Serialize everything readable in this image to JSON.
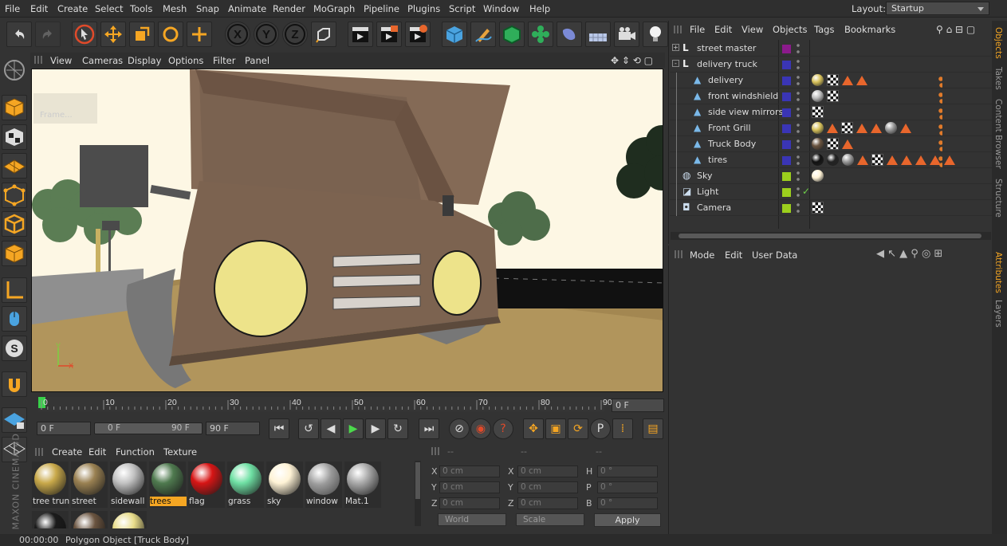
{
  "menubar": {
    "items": [
      "File",
      "Edit",
      "Create",
      "Select",
      "Tools",
      "Mesh",
      "Snap",
      "Animate",
      "Render",
      "MoGraph",
      "Pipeline",
      "Plugins",
      "Script",
      "Window",
      "Help"
    ],
    "layout_label": "Layout:",
    "layout_value": "Startup"
  },
  "toolbar": {
    "buttons": [
      "undo-icon",
      "redo-icon",
      "select-icon",
      "move-icon",
      "scale-icon",
      "rotate-icon",
      "live-select-icon",
      "x-axis-icon",
      "y-axis-icon",
      "z-axis-icon",
      "coordinate-system-icon",
      "render-view-icon",
      "render-picture-viewer-icon",
      "render-settings-icon",
      "cube-icon",
      "pen-icon",
      "subdivision-icon",
      "cloner-icon",
      "deformer-icon",
      "floor-icon",
      "camera-icon",
      "light-icon"
    ],
    "axis_x": "X",
    "axis_y": "Y",
    "axis_z": "Z"
  },
  "viewport_menu": [
    "View",
    "Cameras",
    "Display",
    "Options",
    "Filter",
    "Panel"
  ],
  "viewport_overlay": "Frame...",
  "timeline": {
    "ticks": [
      "0",
      "10",
      "20",
      "30",
      "40",
      "50",
      "60",
      "70",
      "80",
      "90"
    ],
    "current_frame": "0 F"
  },
  "controls": {
    "start_field": "0 F",
    "range_start": "0 F",
    "range_end": "90 F",
    "end_field": "90 F"
  },
  "material_manager": {
    "menu": [
      "Create",
      "Edit",
      "Function",
      "Texture"
    ],
    "materials": [
      {
        "name": "tree trun",
        "color": "#c9a94a"
      },
      {
        "name": "street",
        "color": "#9a8152"
      },
      {
        "name": "sidewall",
        "color": "#c2c2c2"
      },
      {
        "name": "trees",
        "color": "#4f7a4f",
        "selected": true
      },
      {
        "name": "flag",
        "color": "#d71515"
      },
      {
        "name": "grass",
        "color": "#6fe0a4"
      },
      {
        "name": "sky",
        "color": "#fff3d6"
      },
      {
        "name": "window",
        "color": "#8a8a8a"
      },
      {
        "name": "Mat.1",
        "color": "#aaaaaa"
      }
    ],
    "extra_materials": [
      "#1b1b1b",
      "#6a5440",
      "#e8dc8a"
    ]
  },
  "coordinates": {
    "col_headers": [
      "--",
      "--",
      "--"
    ],
    "rows": [
      {
        "a": "X",
        "av": "0 cm",
        "b": "X",
        "bv": "0 cm",
        "c": "H",
        "cv": "0 °"
      },
      {
        "a": "Y",
        "av": "0 cm",
        "b": "Y",
        "bv": "0 cm",
        "c": "P",
        "cv": "0 °"
      },
      {
        "a": "Z",
        "av": "0 cm",
        "b": "Z",
        "bv": "0 cm",
        "c": "B",
        "cv": "0 °"
      }
    ],
    "world": "World",
    "scale": "Scale",
    "apply": "Apply"
  },
  "status": {
    "time": "00:00:00",
    "message": "Polygon Object [Truck Body]"
  },
  "object_manager": {
    "menu": [
      "File",
      "Edit",
      "View",
      "Objects",
      "Tags",
      "Bookmarks"
    ],
    "objects": [
      {
        "name": "street master",
        "icon": "null-icon",
        "color": "#8b1a8b",
        "indent": 0,
        "expand": "+"
      },
      {
        "name": "delivery truck",
        "icon": "null-icon",
        "color": "#3a35b5",
        "indent": 0,
        "expand": "-"
      },
      {
        "name": "delivery",
        "icon": "polygon-icon",
        "color": "#3a35b5",
        "indent": 1
      },
      {
        "name": "front windshield",
        "icon": "polygon-icon",
        "color": "#3a35b5",
        "indent": 1
      },
      {
        "name": "side view mirrors",
        "icon": "polygon-icon",
        "color": "#3a35b5",
        "indent": 1
      },
      {
        "name": "Front Grill",
        "icon": "polygon-icon",
        "color": "#3a35b5",
        "indent": 1
      },
      {
        "name": "Truck Body",
        "icon": "polygon-icon",
        "color": "#3a35b5",
        "indent": 1
      },
      {
        "name": "tires",
        "icon": "polygon-icon",
        "color": "#3a35b5",
        "indent": 1
      },
      {
        "name": "Sky",
        "icon": "sky-icon",
        "color": "#9ccf1d",
        "indent": 0
      },
      {
        "name": "Light",
        "icon": "light-icon",
        "color": "#9ccf1d",
        "indent": 0
      },
      {
        "name": "Camera",
        "icon": "camera-icon",
        "color": "#9ccf1d",
        "indent": 0
      }
    ]
  },
  "attribute_manager": {
    "menu": [
      "Mode",
      "Edit",
      "User Data"
    ]
  },
  "side_tabs": [
    "Objects",
    "Takes",
    "Content Browser",
    "Structure",
    "Attributes",
    "Layers"
  ],
  "brand": "MAXON CINEMA 4D"
}
